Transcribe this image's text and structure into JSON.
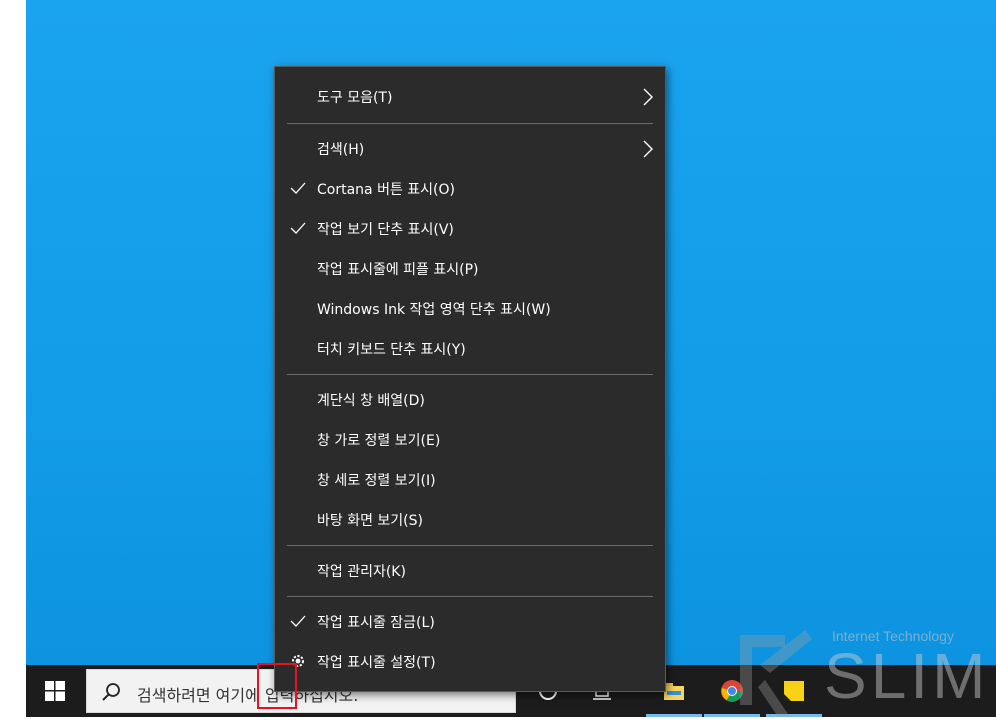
{
  "context_menu": {
    "items": [
      {
        "label": "도구 모음(T)",
        "checked": false,
        "submenu": true
      },
      {
        "label": "검색(H)",
        "checked": false,
        "submenu": true
      },
      {
        "label": "Cortana 버튼 표시(O)",
        "checked": true,
        "submenu": false
      },
      {
        "label": "작업 보기 단추 표시(V)",
        "checked": true,
        "submenu": false
      },
      {
        "label": "작업 표시줄에 피플 표시(P)",
        "checked": false,
        "submenu": false
      },
      {
        "label": "Windows Ink 작업 영역 단추 표시(W)",
        "checked": false,
        "submenu": false
      },
      {
        "label": "터치 키보드 단추 표시(Y)",
        "checked": false,
        "submenu": false
      },
      {
        "label": "계단식 창 배열(D)",
        "checked": false,
        "submenu": false
      },
      {
        "label": "창 가로 정렬 보기(E)",
        "checked": false,
        "submenu": false
      },
      {
        "label": "창 세로 정렬 보기(I)",
        "checked": false,
        "submenu": false
      },
      {
        "label": "바탕 화면 보기(S)",
        "checked": false,
        "submenu": false
      },
      {
        "label": "작업 관리자(K)",
        "checked": false,
        "submenu": false
      },
      {
        "label": "작업 표시줄 잠금(L)",
        "checked": true,
        "submenu": false
      },
      {
        "label": "작업 표시줄 설정(T)",
        "checked": false,
        "submenu": false,
        "icon": "gear-icon"
      }
    ]
  },
  "taskbar": {
    "search_placeholder": "검색하려면 여기에 입력하십시오.",
    "icons": [
      "windows-start-icon",
      "search-icon",
      "cortana-icon",
      "task-view-icon",
      "file-explorer-icon",
      "chrome-icon",
      "sticky-notes-icon"
    ]
  },
  "watermark": {
    "small_text": "Internet Technology",
    "big_text": "SLIM"
  },
  "colors": {
    "desktop_bg": "#1aa3ef",
    "taskbar_bg": "#1c1c1c",
    "menu_bg": "#2b2b2b",
    "highlight": "#e81123",
    "accent_underline": "#76b9ed"
  }
}
